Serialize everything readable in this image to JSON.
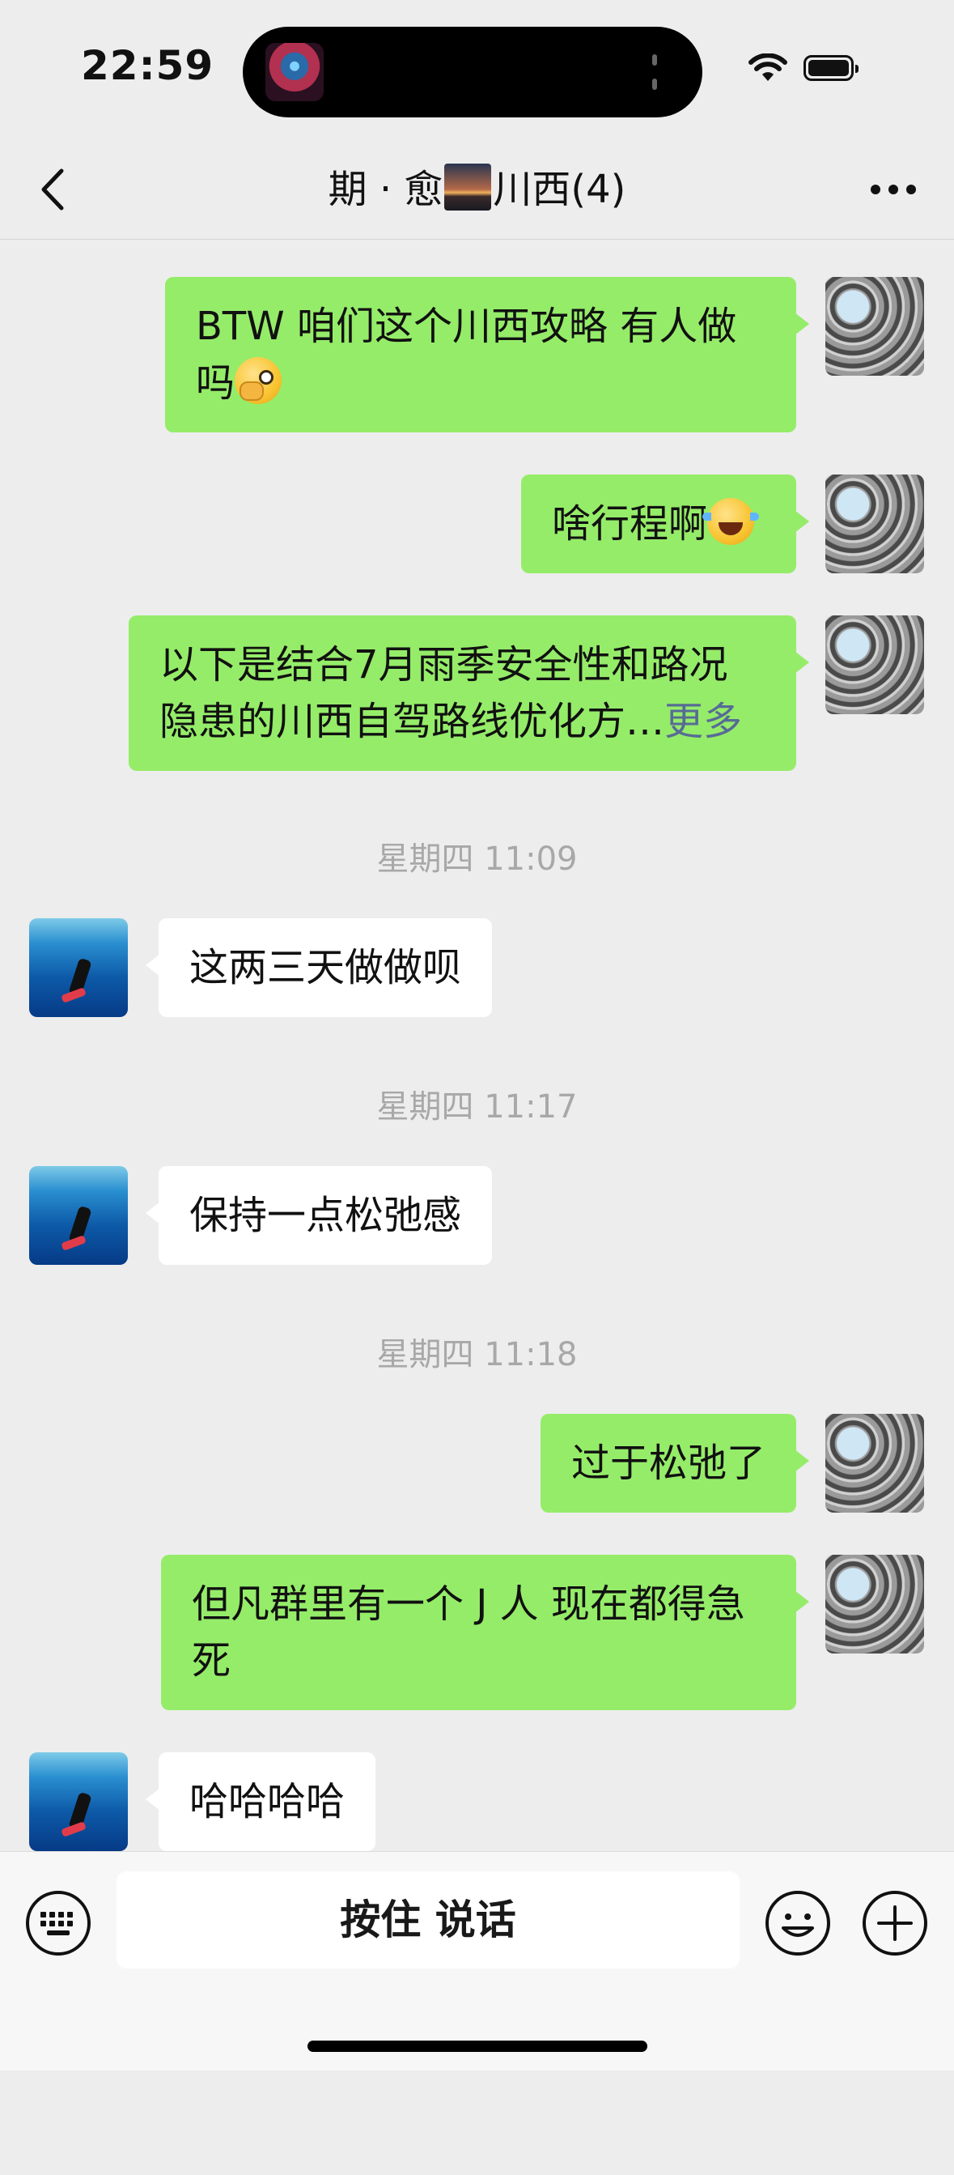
{
  "status_bar": {
    "time": "22:59"
  },
  "header": {
    "title_prefix": "期 · 愈",
    "title_suffix": "川西(4)"
  },
  "messages": [
    {
      "side": "me",
      "text": "BTW  咱们这个川西攻略 有人做吗",
      "emoji": "peeking-eye-emoji"
    },
    {
      "side": "me",
      "text": "啥行程啊",
      "emoji": "laugh-cry-emoji"
    },
    {
      "side": "me",
      "text_line1": "以下是结合7月雨季安全性和路况",
      "text_line2": "隐患的川西自驾路线优化方…",
      "more": "更多"
    },
    {
      "timestamp": "星期四 11:09"
    },
    {
      "side": "other",
      "text": "这两三天做做呗"
    },
    {
      "timestamp": "星期四 11:17"
    },
    {
      "side": "other",
      "text": "保持一点松弛感"
    },
    {
      "timestamp": "星期四 11:18"
    },
    {
      "side": "me",
      "text": "过于松弛了"
    },
    {
      "side": "me",
      "text": "但凡群里有一个 J 人 现在都得急死"
    },
    {
      "side": "other",
      "text": "哈哈哈哈"
    }
  ],
  "input_bar": {
    "hold_to_talk": "按住 说话"
  },
  "icons": {
    "back": "chevron-left-icon",
    "more": "ellipsis-icon",
    "keyboard": "keyboard-icon",
    "emoji": "smile-icon",
    "plus": "plus-icon"
  },
  "colors": {
    "my_bubble": "#95ec69",
    "other_bubble": "#ffffff",
    "background": "#ededed",
    "link": "#576b95"
  }
}
